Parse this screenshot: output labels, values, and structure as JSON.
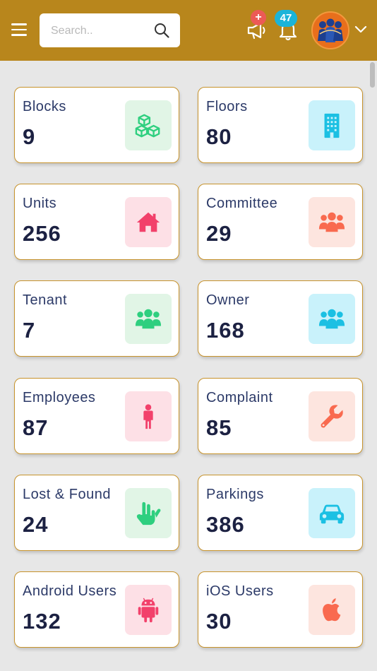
{
  "header": {
    "search_placeholder": "Search..",
    "announcement_badge": "+",
    "notification_count": "47"
  },
  "stats": [
    {
      "label": "Blocks",
      "value": "9",
      "icon": "cubes-icon",
      "color": "#2ecf7f"
    },
    {
      "label": "Floors",
      "value": "80",
      "icon": "building-icon",
      "color": "#1bc0e3"
    },
    {
      "label": "Units",
      "value": "256",
      "icon": "home-icon",
      "color": "#f2416b"
    },
    {
      "label": "Committee",
      "value": "29",
      "icon": "users-icon",
      "color": "#f96a4f"
    },
    {
      "label": "Tenant",
      "value": "7",
      "icon": "users-icon",
      "color": "#2ecf7f"
    },
    {
      "label": "Owner",
      "value": "168",
      "icon": "users-icon",
      "color": "#1bc0e3"
    },
    {
      "label": "Employees",
      "value": "87",
      "icon": "person-icon",
      "color": "#f2416b"
    },
    {
      "label": "Complaint",
      "value": "85",
      "icon": "wrench-icon",
      "color": "#f96a4f"
    },
    {
      "label": "Lost & Found",
      "value": "24",
      "icon": "hands-icon",
      "color": "#2ecf7f"
    },
    {
      "label": "Parkings",
      "value": "386",
      "icon": "car-icon",
      "color": "#1bc0e3"
    },
    {
      "label": "Android Users",
      "value": "132",
      "icon": "android-icon",
      "color": "#f2416b"
    },
    {
      "label": "iOS Users",
      "value": "30",
      "icon": "apple-icon",
      "color": "#f96a4f"
    }
  ]
}
